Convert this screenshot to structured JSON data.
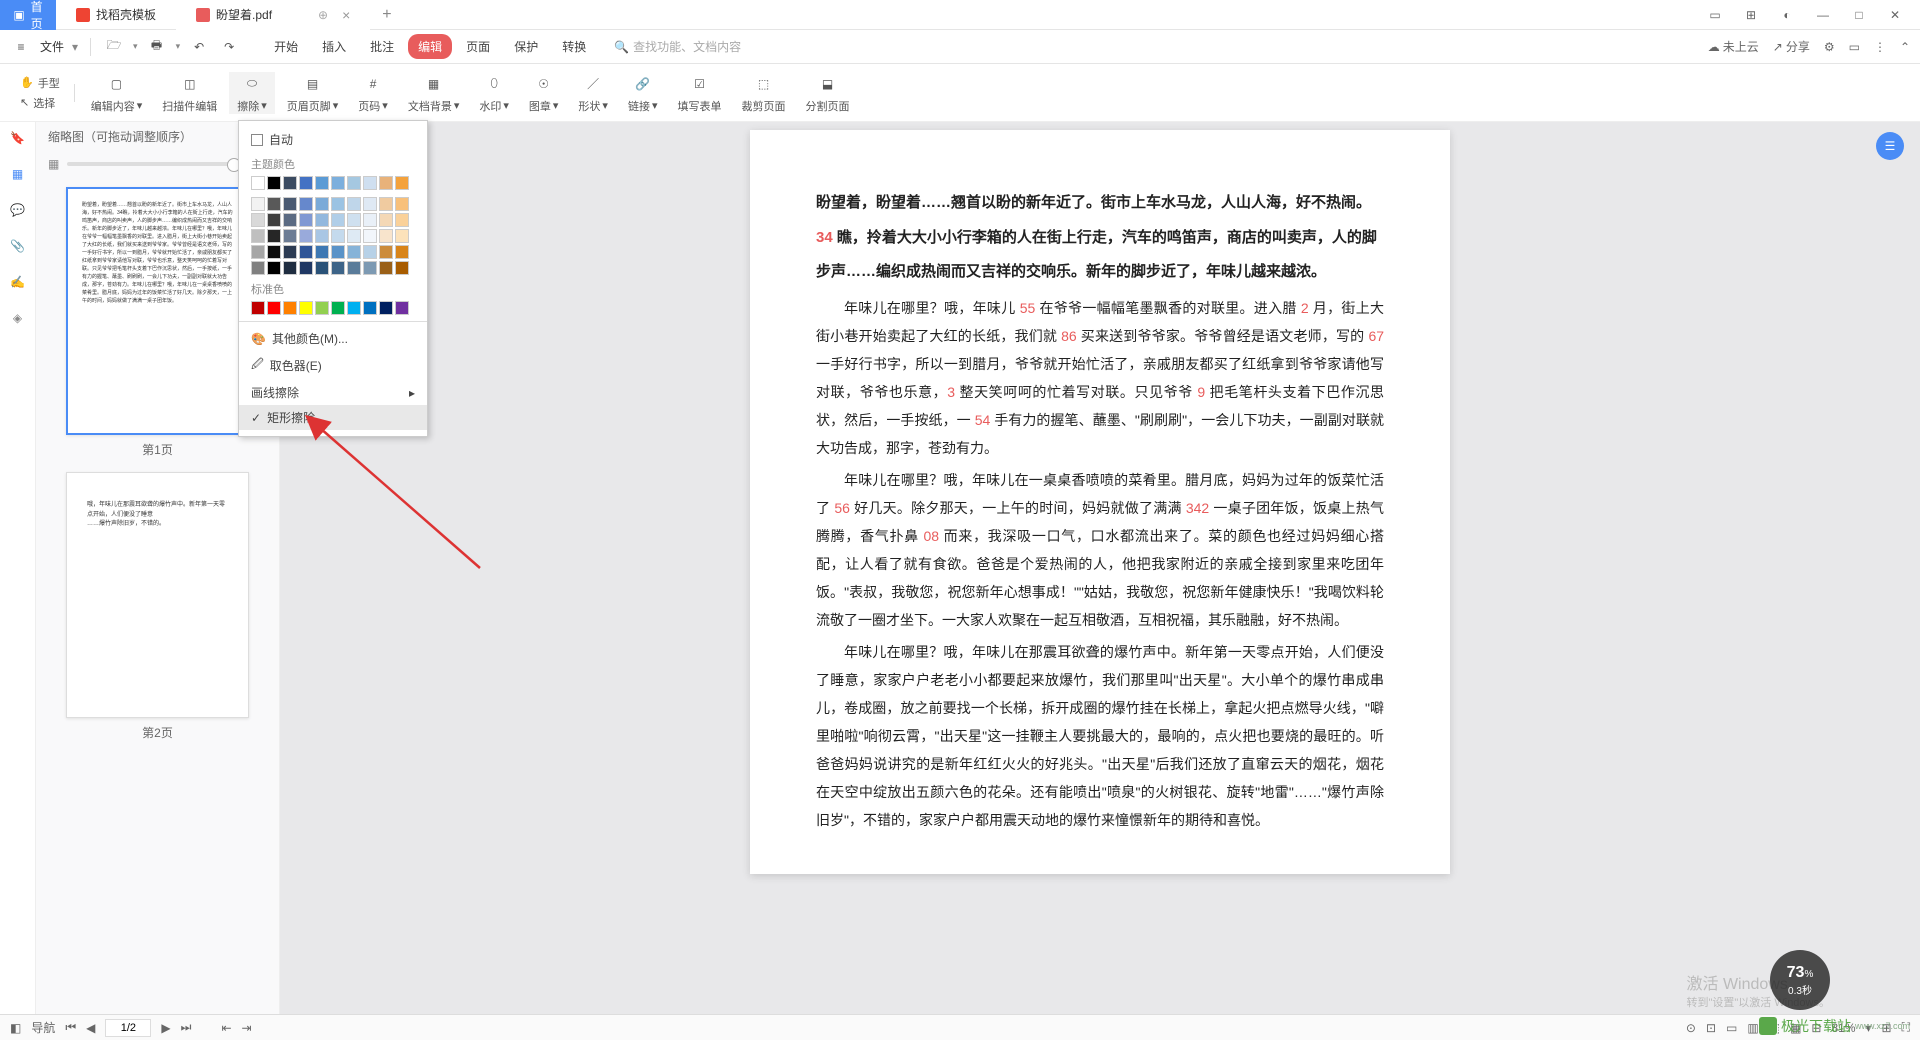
{
  "tabs": {
    "home": "首页",
    "template": "找稻壳模板",
    "file": "盼望着.pdf"
  },
  "menubar": {
    "file": "文件",
    "tabs": [
      "开始",
      "插入",
      "批注",
      "编辑",
      "页面",
      "保护",
      "转换"
    ],
    "active": "编辑",
    "search": "查找功能、文档内容",
    "cloud": "未上云",
    "share": "分享"
  },
  "tool_column": {
    "hand": "手型",
    "select": "选择"
  },
  "ribbon": {
    "items": [
      "编辑内容",
      "扫描件编辑",
      "擦除",
      "页眉页脚",
      "页码",
      "文档背景",
      "水印",
      "图章",
      "形状",
      "链接",
      "填写表单",
      "裁剪页面",
      "分割页面"
    ]
  },
  "sidebar": {
    "header": "缩略图（可拖动调整顺序）"
  },
  "thumbs": {
    "p1": "第1页",
    "p2": "第2页"
  },
  "dropdown": {
    "auto": "自动",
    "theme": "主题颜色",
    "standard": "标准色",
    "more": "其他颜色(M)...",
    "picker": "取色器(E)",
    "line": "画线擦除",
    "rect": "矩形擦除",
    "theme_top": [
      "#ffffff",
      "#000000",
      "#3b4b61",
      "#4472c4",
      "#5b9bd5",
      "#7cafdd",
      "#a5c8e1",
      "#cfdff0",
      "#e8b27a",
      "#f4a23c"
    ],
    "theme_grid": [
      [
        "#f2f2f2",
        "#595959",
        "#4a5a72",
        "#6688cc",
        "#7aaad8",
        "#9bc3e3",
        "#bfd6ea",
        "#dfe9f4",
        "#f0cba0",
        "#f8c07a"
      ],
      [
        "#d9d9d9",
        "#404040",
        "#5b6b83",
        "#8099d3",
        "#92b8de",
        "#b0cee8",
        "#cfe0ef",
        "#e9f0f8",
        "#f4d8b6",
        "#fad19a"
      ],
      [
        "#bfbfbf",
        "#262626",
        "#6c7c94",
        "#99aadb",
        "#a9c6e4",
        "#c4daed",
        "#deeaf4",
        "#f2f6fb",
        "#f8e4cc",
        "#fce2ba"
      ],
      [
        "#a6a6a6",
        "#0d0d0d",
        "#2c3b52",
        "#2f5597",
        "#3e78b3",
        "#5a93c8",
        "#86b3d8",
        "#b7d1e7",
        "#cc8c3c",
        "#d8841a"
      ],
      [
        "#808080",
        "#000000",
        "#1f2d40",
        "#203864",
        "#2a5278",
        "#3d6488",
        "#5a7c9a",
        "#7d9ab3",
        "#9a6018",
        "#a85c00"
      ]
    ],
    "standard_row": [
      "#c00000",
      "#ff0000",
      "#ff8000",
      "#ffff00",
      "#92d050",
      "#00b050",
      "#00b0f0",
      "#0070c0",
      "#002060",
      "#7030a0"
    ]
  },
  "document": {
    "para1_a": "盼望着，盼望着……翘首以盼的新年近了。街市上车水马龙，人山人海，好不热闹。",
    "para1_n1": "34",
    "para1_b": " 瞧，拎着大大小小行李箱的人在街上行走，汽车的鸣笛声，商店的叫卖声，人的脚步声……编织成热闹而又吉祥的交响乐。新年的脚步近了，年味儿越来越浓。",
    "para2_a": "年味儿在哪里？哦，年味儿 ",
    "para2_n1": "55",
    "para2_b": " 在爷爷一幅幅笔墨飘香的对联里。进入腊 ",
    "para2_n2": "2",
    "para2_c": " 月，街上大街小巷开始卖起了大红的长纸，我们就 ",
    "para2_n3": "86",
    "para2_d": " 买来送到爷爷家。爷爷曾经是语文老师，写的 ",
    "para2_n4": "67",
    "para2_e": " 一手好行书字，所以一到腊月，爷爷就开始忙活了，亲戚朋友都买了红纸拿到爷爷家请他写对联，爷爷也乐意，",
    "para2_n5": "3",
    "para2_f": " 整天笑呵呵的忙着写对联。只见爷爷 ",
    "para2_n6": "9",
    "para2_g": " 把毛笔杆头支着下巴作沉思状，然后，一手按纸，一 ",
    "para2_n7": "54",
    "para2_h": " 手有力的握笔、蘸墨、\"刷刷刷\"，一会儿下功夫，一副副对联就大功告成，那字，苍劲有力。",
    "para3_a": "年味儿在哪里？哦，年味儿在一桌桌香喷喷的菜肴里。腊月底，妈妈为过年的饭菜忙活了 ",
    "para3_n1": "56",
    "para3_b": " 好几天。除夕那天，一上午的时间，妈妈就做了满满 ",
    "para3_n2": "342",
    "para3_c": " 一桌子团年饭，饭桌上热气腾腾，香气扑鼻 ",
    "para3_n3": "08",
    "para3_d": " 而来，我深吸一口气，口水都流出来了。菜的颜色也经过妈妈细心搭配，让人看了就有食欲。爸爸是个爱热闹的人，他把我家附近的亲戚全接到家里来吃团年饭。\"表叔，我敬您，祝您新年心想事成！\"\"姑姑，我敬您，祝您新年健康快乐！\"我喝饮料轮流敬了一圈才坐下。一大家人欢聚在一起互相敬酒，互相祝福，其乐融融，好不热闹。",
    "para4": "年味儿在哪里？哦，年味儿在那震耳欲聋的爆竹声中。新年第一天零点开始，人们便没了睡意，家家户户老老小小都要起来放爆竹，我们那里叫\"出天星\"。大小单个的爆竹串成串儿，卷成圈，放之前要找一个长梯，拆开成圈的爆竹挂在长梯上，拿起火把点燃导火线，\"噼里啪啦\"响彻云霄，\"出天星\"这一挂鞭主人要挑最大的，最响的，点火把也要烧的最旺的。听爸爸妈妈说讲究的是新年红红火火的好兆头。\"出天星\"后我们还放了直窜云天的烟花，烟花在天空中绽放出五颜六色的花朵。还有能喷出\"喷泉\"的火树银花、旋转\"地雷\"……\"爆竹声除旧岁\"，不错的，家家户户都用震天动地的爆竹来憧憬新年的期待和喜悦。"
  },
  "statusbar": {
    "nav": "导航",
    "page": "1/2",
    "zoom": "81%"
  },
  "badge": {
    "pct": "73",
    "unit": "%",
    "sub": "0.3秒"
  },
  "activate": {
    "l1": "激活 Windows",
    "l2": "转到\"设置\"以激活 Windows。"
  },
  "watermark": "极光下载站"
}
